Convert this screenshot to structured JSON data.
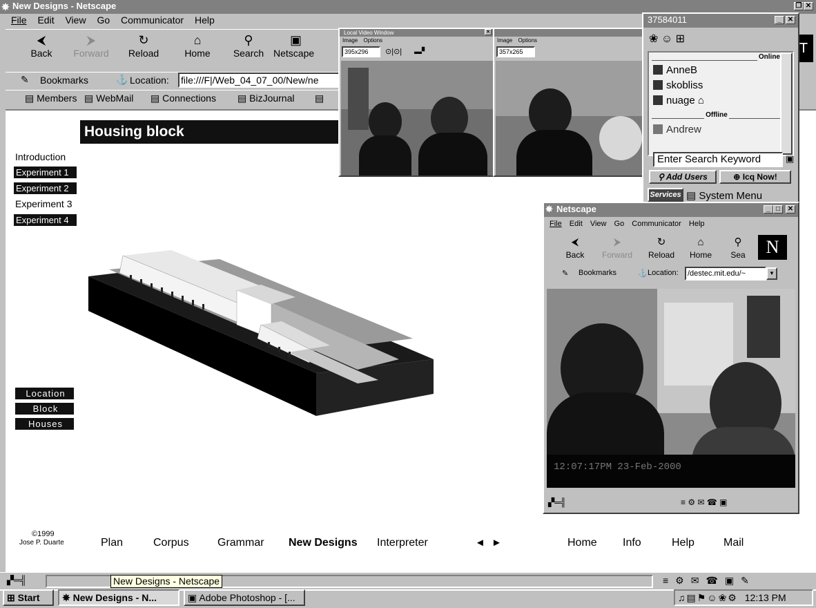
{
  "main_window": {
    "title": "New Designs - Netscape",
    "menu": [
      "File",
      "Edit",
      "View",
      "Go",
      "Communicator",
      "Help"
    ],
    "toolbar": {
      "back": "Back",
      "forward": "Forward",
      "reload": "Reload",
      "home": "Home",
      "search": "Search",
      "netscape": "Netscape"
    },
    "bookmarks_label": "Bookmarks",
    "location_label": "Location:",
    "location_value": "file:///F|/Web_04_07_00/New/ne",
    "personal_toolbar": [
      "Members",
      "WebMail",
      "Connections",
      "BizJournal"
    ]
  },
  "page": {
    "header": "Housing block",
    "sidebar_top": [
      {
        "label": "Introduction",
        "style": "plain"
      },
      {
        "label": "Experiment 1",
        "style": "dark"
      },
      {
        "label": "Experiment 2",
        "style": "dark"
      },
      {
        "label": "Experiment 3",
        "style": "plain"
      },
      {
        "label": "Experiment 4",
        "style": "dark"
      }
    ],
    "sidebar_bottom": [
      "Location",
      "Block",
      "Houses"
    ],
    "copyright_year": "©1999",
    "copyright_name": "Jose P. Duarte",
    "footer_nav": [
      "Plan",
      "Corpus",
      "Grammar",
      "New Designs",
      "Interpreter"
    ],
    "arrows": [
      "◄",
      "►"
    ],
    "footer_nav_right": [
      "Home",
      "Info",
      "Help",
      "Mail"
    ]
  },
  "video_window": {
    "title": "Local Video Window",
    "menu": [
      "Image",
      "Options"
    ],
    "size_value": "395x296",
    "size_value_2": "357x265"
  },
  "icq_window": {
    "title": "37584011",
    "online_label": "Online",
    "online": [
      "AnneB",
      "skobliss",
      "nuage"
    ],
    "offline_label": "Offline",
    "offline": [
      "Andrew"
    ],
    "search_placeholder": "Enter Search Keyword",
    "add_users": "Add Users",
    "icq_now": "Icq Now!",
    "services": "Services",
    "system_menu": "System Menu"
  },
  "second_window": {
    "title": "Netscape",
    "menu": [
      "File",
      "Edit",
      "View",
      "Go",
      "Communicator",
      "Help"
    ],
    "toolbar": {
      "back": "Back",
      "forward": "Forward",
      "reload": "Reload",
      "home": "Home",
      "search": "Sea"
    },
    "bookmarks_label": "Bookmarks",
    "location_label": "Location:",
    "location_value": "/destec.mit.edu/~",
    "webcam_timestamp": "12:07:17PM 23-Feb-2000"
  },
  "status_tooltip": "New Designs - Netscape",
  "taskbar": {
    "start": "Start",
    "items": [
      "New Designs - N...",
      "Adobe Photoshop - [..."
    ],
    "clock": "12:13 PM"
  }
}
